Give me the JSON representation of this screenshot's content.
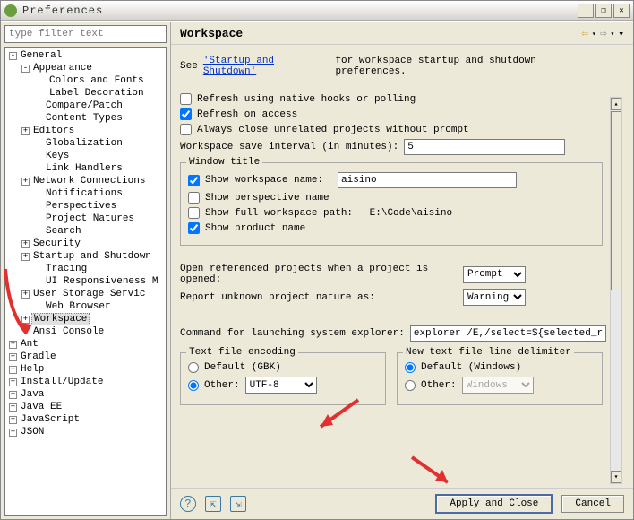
{
  "window": {
    "title": "Preferences",
    "minimize_glyph": "_",
    "restore_glyph": "❐",
    "close_glyph": "✕"
  },
  "filter": {
    "placeholder": "type filter text"
  },
  "tree": {
    "general": "General",
    "appearance": "Appearance",
    "colors_fonts": "Colors and Fonts",
    "label_decoration": "Label Decoration",
    "compare_patch": "Compare/Patch",
    "content_types": "Content Types",
    "editors": "Editors",
    "globalization": "Globalization",
    "keys": "Keys",
    "link_handlers": "Link Handlers",
    "network": "Network Connections",
    "notifications": "Notifications",
    "perspectives": "Perspectives",
    "project_natures": "Project Natures",
    "search": "Search",
    "security": "Security",
    "startup_shutdown": "Startup and Shutdown",
    "tracing": "Tracing",
    "ui_responsiveness": "UI Responsiveness M",
    "user_storage": "User Storage Servic",
    "web_browser": "Web Browser",
    "workspace": "Workspace",
    "ansi_console": "Ansi Console",
    "ant": "Ant",
    "gradle": "Gradle",
    "help": "Help",
    "install_update": "Install/Update",
    "java": "Java",
    "java_ee": "Java EE",
    "javascript": "JavaScript",
    "json": "JSON"
  },
  "header": {
    "title": "Workspace",
    "back_glyph": "⇦",
    "fwd_glyph": "⇨",
    "menu_glyph": "▾"
  },
  "page": {
    "see_prefix": "See ",
    "see_link": "'Startup and Shutdown'",
    "see_suffix": " for workspace startup and shutdown preferences.",
    "cb_refresh_native": "Refresh using native hooks or polling",
    "cb_refresh_access": "Refresh on access",
    "cb_always_close": "Always close unrelated projects without prompt",
    "save_interval_label": "Workspace save interval (in minutes):",
    "save_interval_value": "5",
    "window_title_legend": "Window title",
    "cb_show_ws_name": "Show workspace name:",
    "ws_name_value": "aisino",
    "cb_show_perspective": "Show perspective name",
    "cb_show_full_path": "Show full workspace path:",
    "full_path_value": "E:\\Code\\aisino",
    "cb_show_product": "Show product name",
    "open_ref_label": "Open referenced projects when a project is opened:",
    "open_ref_value": "Prompt",
    "report_nature_label": "Report unknown project nature as:",
    "report_nature_value": "Warning",
    "command_explorer_label": "Command for launching system explorer:",
    "command_explorer_value": "explorer /E,/select=${selected_resource_",
    "encoding_legend": "Text file encoding",
    "encoding_default": "Default (GBK)",
    "encoding_other": "Other:",
    "encoding_value": "UTF-8",
    "delimiter_legend": "New text file line delimiter",
    "delimiter_default": "Default (Windows)",
    "delimiter_other": "Other:",
    "delimiter_value": "Windows"
  },
  "footer": {
    "help_glyph": "?",
    "import_glyph": "⇱",
    "export_glyph": "⇲",
    "apply_close": "Apply and Close",
    "cancel": "Cancel"
  }
}
